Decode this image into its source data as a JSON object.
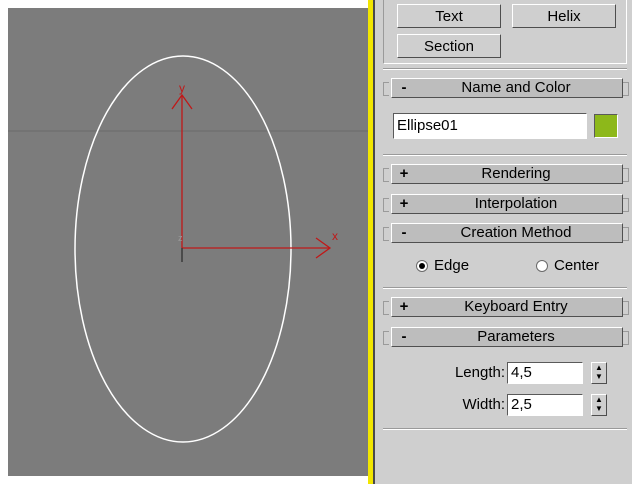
{
  "viewport": {
    "axis_labels": {
      "y": "y",
      "x": "x",
      "z": "z"
    },
    "colors": {
      "background": "#7c7c7c",
      "shape": "#ffffff",
      "axis": "#c01818",
      "grid": "#6a6a6a"
    }
  },
  "object_type_buttons": {
    "text_label": "Text",
    "helix_label": "Helix",
    "section_label": "Section"
  },
  "name_and_color": {
    "sign": "-",
    "title": "Name and Color",
    "name_value": "Ellipse01",
    "color": "#8db81a"
  },
  "rollouts": {
    "rendering": {
      "sign": "+",
      "title": "Rendering"
    },
    "interpolation": {
      "sign": "+",
      "title": "Interpolation"
    },
    "creation_method": {
      "sign": "-",
      "title": "Creation Method"
    },
    "keyboard_entry": {
      "sign": "+",
      "title": "Keyboard Entry"
    },
    "parameters": {
      "sign": "-",
      "title": "Parameters"
    }
  },
  "creation_method": {
    "options": [
      {
        "label": "Edge",
        "selected": true
      },
      {
        "label": "Center",
        "selected": false
      }
    ]
  },
  "parameters": {
    "length_label": "Length:",
    "length_value": "4,5",
    "width_label": "Width:",
    "width_value": "2,5",
    "spinner_up": "▲",
    "spinner_down": "▼"
  }
}
